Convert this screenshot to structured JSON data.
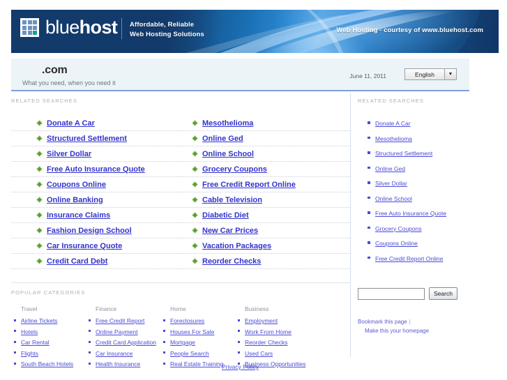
{
  "banner": {
    "logo_text_light": "blue",
    "logo_text_bold": "host",
    "tagline_line1": "Affordable, Reliable",
    "tagline_line2": "Web Hosting Solutions",
    "courtesy": "Web Hosting - courtesy of www.bluehost.com",
    "accent_color": "#14a39a",
    "brand_color": "#123a6b"
  },
  "titlebar": {
    "domain": ".com",
    "subtitle": "What you need, when you need it",
    "date": "June 11, 2011",
    "language": "English",
    "language_options": [
      "English"
    ]
  },
  "main": {
    "related_label": "RELATED SEARCHES",
    "column1": [
      "Donate A Car",
      "Structured Settlement",
      "Silver Dollar",
      "Free Auto Insurance Quote",
      "Coupons Online",
      "Online Banking",
      "Insurance Claims",
      "Fashion Design School",
      "Car Insurance Quote",
      "Credit Card Debt"
    ],
    "column2": [
      "Mesothelioma",
      "Online Ged",
      "Online School",
      "Grocery Coupons",
      "Free Credit Report Online",
      "Cable Television",
      "Diabetic Diet",
      "New Car Prices",
      "Vacation Packages",
      "Reorder Checks"
    ]
  },
  "categories": {
    "label": "POPULAR CATEGORIES",
    "groups": [
      {
        "title": "Travel",
        "items": [
          "Airline Tickets",
          "Hotels",
          "Car Rental",
          "Flights",
          "South Beach Hotels"
        ]
      },
      {
        "title": "Finance",
        "items": [
          "Free Credit Report",
          "Online Payment",
          "Credit Card Application",
          "Car Insurance",
          "Health Insurance"
        ]
      },
      {
        "title": "Home",
        "items": [
          "Foreclosures",
          "Houses For Sale",
          "Mortgage",
          "People Search",
          "Real Estate Training"
        ]
      },
      {
        "title": "Business",
        "items": [
          "Employment",
          "Work From Home",
          "Reorder Checks",
          "Used Cars",
          "Business Opportunities"
        ]
      }
    ]
  },
  "sidebar": {
    "related_label": "RELATED SEARCHES",
    "items": [
      "Donate A Car",
      "Mesothelioma",
      "Structured Settlement",
      "Online Ged",
      "Silver Dollar",
      "Online School",
      "Free Auto Insurance Quote",
      "Grocery Coupons",
      "Coupons Online",
      "Free Credit Report Online"
    ],
    "search_value": "",
    "search_placeholder": "",
    "search_button": "Search",
    "bookmark_link": "Bookmark this page",
    "separator": "|",
    "homepage_link": "Make this your homepage"
  },
  "footer": {
    "privacy_policy": "Privacy Policy"
  }
}
